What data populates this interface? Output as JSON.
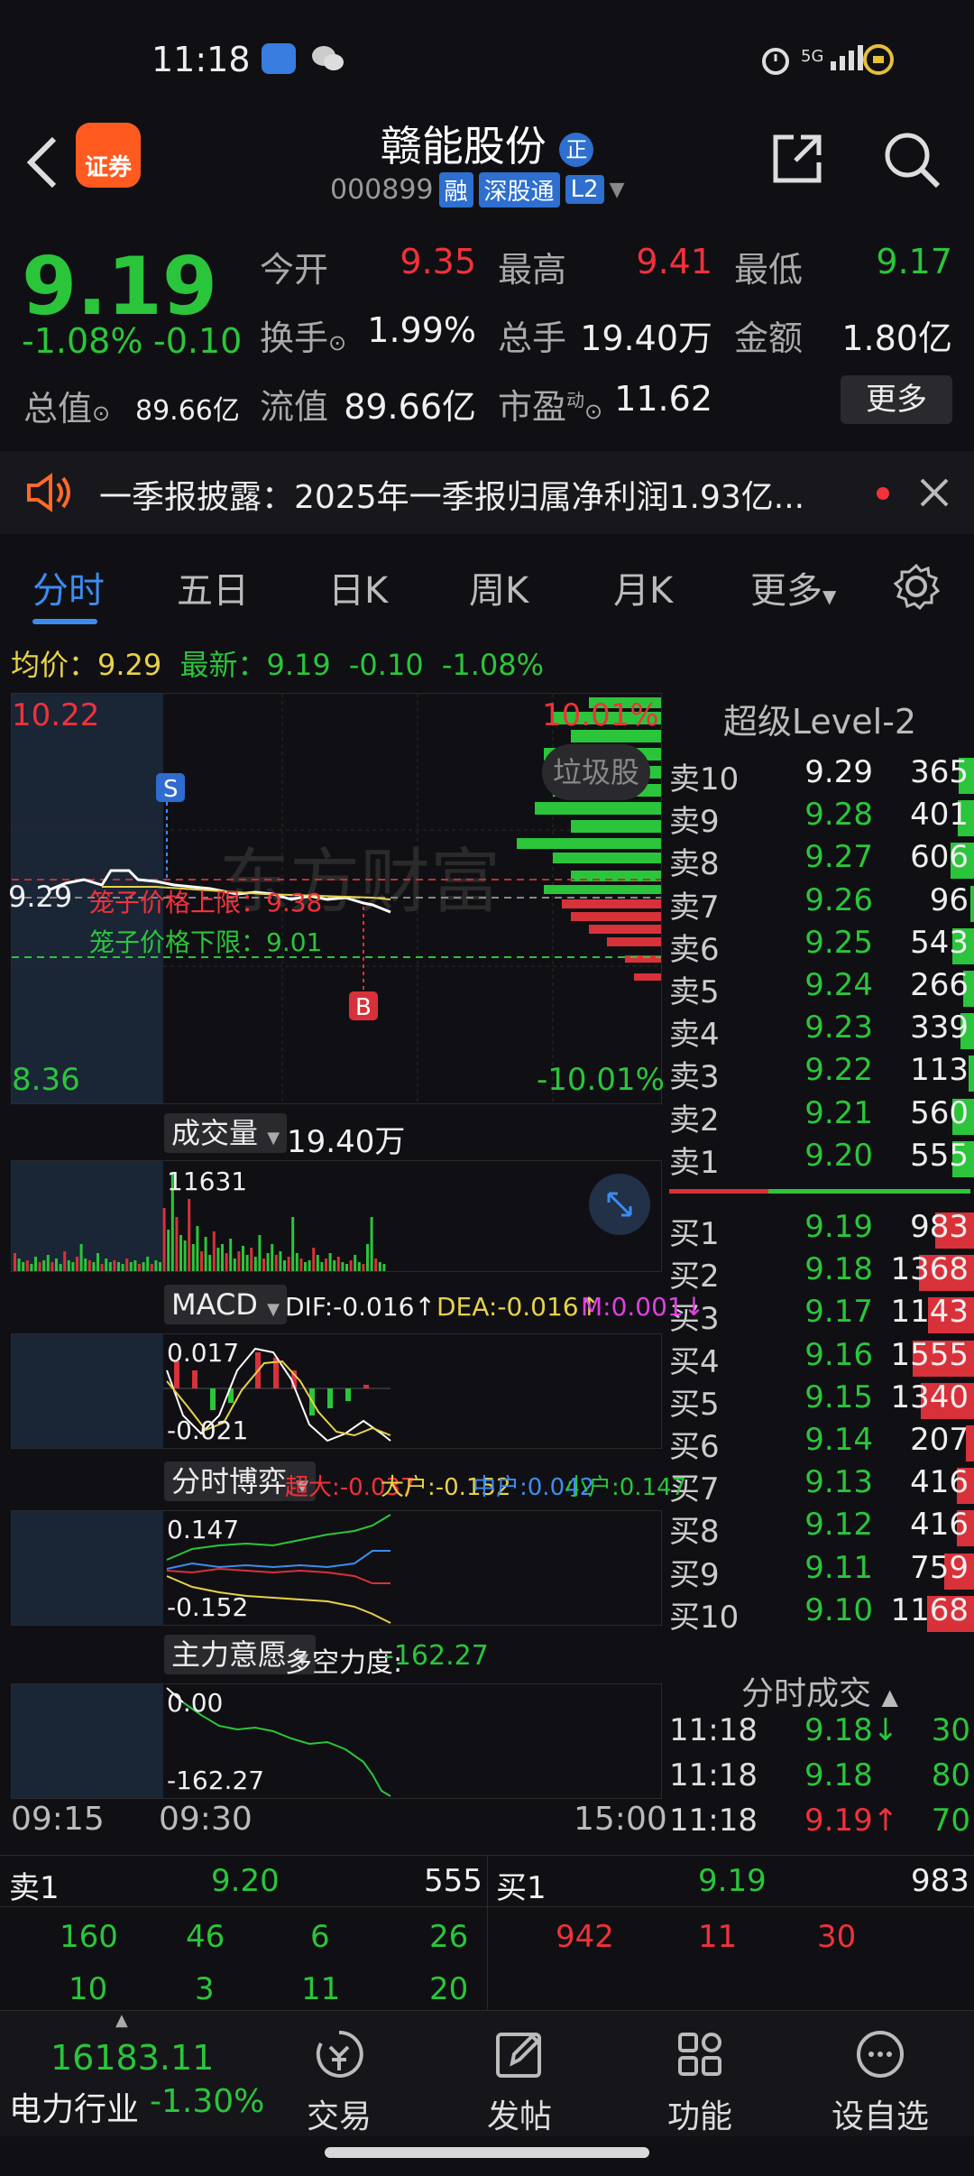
{
  "status_bar": {
    "time": "11:18",
    "network": "5G"
  },
  "header": {
    "logo_text": "证券",
    "stock_name": "赣能股份",
    "stock_code": "000899",
    "tags": [
      "融",
      "深股通",
      "L2"
    ]
  },
  "quote": {
    "price": "9.19",
    "change_pct": "-1.08%",
    "change_val": "-0.10",
    "open_label": "今开",
    "open": "9.35",
    "high_label": "最高",
    "high": "9.41",
    "low_label": "最低",
    "low": "9.17",
    "turnover_label": "换手",
    "turnover": "1.99%",
    "volume_label": "总手",
    "volume": "19.40万",
    "amount_label": "金额",
    "amount": "1.80亿",
    "mktcap_label": "总值",
    "mktcap": "89.66亿",
    "float_label": "流值",
    "float": "89.66亿",
    "pe_label": "市盈",
    "pe_sup": "动",
    "pe": "11.62",
    "more_label": "更多"
  },
  "notice": {
    "text": "一季报披露：2025年一季报归属净利润1.93亿..."
  },
  "tabs": [
    "分时",
    "五日",
    "日K",
    "周K",
    "月K",
    "更多"
  ],
  "avg_bar": {
    "avg_label": "均价：",
    "avg": "9.29",
    "latest_label": "最新：",
    "latest": "9.19",
    "chg": "-0.10",
    "pct": "-1.08%"
  },
  "chart": {
    "top_price": "10.22",
    "bottom_price": "8.36",
    "top_pct": "10.01%",
    "bottom_pct": "-10.01%",
    "mid_price": "9.29",
    "cage_upper": "笼子价格上限：9.38",
    "cage_lower": "笼子价格下限：9.01",
    "marker_s": "S",
    "marker_b": "B",
    "watermark": "东方财富",
    "overlay_btn": "垃圾股"
  },
  "volume_panel": {
    "title": "成交量",
    "value": "19.40万",
    "max": "11631"
  },
  "macd_panel": {
    "title": "MACD",
    "dif": "DIF:-0.016↑",
    "dea": "DEA:-0.016↑",
    "m": "M:0.001↓",
    "top": "0.017",
    "bottom": "-0.021"
  },
  "game_panel": {
    "title": "分时博弈",
    "xl": "超大:-0.037",
    "l": "大户:-0.152",
    "m": "中户:0.042",
    "s": "小户:0.147",
    "top": "0.147",
    "bottom": "-0.152"
  },
  "main_panel": {
    "title": "主力意愿",
    "info_label": "多空力度:",
    "info_val": "-162.27",
    "top": "0.00",
    "bottom": "-162.27"
  },
  "time_axis": [
    "09:15",
    "09:30",
    "15:00"
  ],
  "orderbook": {
    "title": "超级Level-2",
    "asks": [
      {
        "label": "卖10",
        "price": "9.29",
        "vol": "365",
        "fill": 0.15
      },
      {
        "label": "卖9",
        "price": "9.28",
        "vol": "401",
        "fill": 0.16
      },
      {
        "label": "卖8",
        "price": "9.27",
        "vol": "606",
        "fill": 0.24
      },
      {
        "label": "卖7",
        "price": "9.26",
        "vol": "96",
        "fill": 0.04
      },
      {
        "label": "卖6",
        "price": "9.25",
        "vol": "543",
        "fill": 0.22
      },
      {
        "label": "卖5",
        "price": "9.24",
        "vol": "266",
        "fill": 0.11
      },
      {
        "label": "卖4",
        "price": "9.23",
        "vol": "339",
        "fill": 0.14
      },
      {
        "label": "卖3",
        "price": "9.22",
        "vol": "113",
        "fill": 0.05
      },
      {
        "label": "卖2",
        "price": "9.21",
        "vol": "560",
        "fill": 0.22
      },
      {
        "label": "卖1",
        "price": "9.20",
        "vol": "555",
        "fill": 0.22
      }
    ],
    "bids": [
      {
        "label": "买1",
        "price": "9.19",
        "vol": "983",
        "fill": 0.39
      },
      {
        "label": "买2",
        "price": "9.18",
        "vol": "1368",
        "fill": 0.55
      },
      {
        "label": "买3",
        "price": "9.17",
        "vol": "1143",
        "fill": 0.46
      },
      {
        "label": "买4",
        "price": "9.16",
        "vol": "1555",
        "fill": 0.62
      },
      {
        "label": "买5",
        "price": "9.15",
        "vol": "1340",
        "fill": 0.54
      },
      {
        "label": "买6",
        "price": "9.14",
        "vol": "207",
        "fill": 0.08
      },
      {
        "label": "买7",
        "price": "9.13",
        "vol": "416",
        "fill": 0.17
      },
      {
        "label": "买8",
        "price": "9.12",
        "vol": "416",
        "fill": 0.17
      },
      {
        "label": "买9",
        "price": "9.11",
        "vol": "759",
        "fill": 0.3
      },
      {
        "label": "买10",
        "price": "9.10",
        "vol": "1168",
        "fill": 0.47
      }
    ],
    "ask_color": "#2bc53b",
    "bid_color": "#d9313a"
  },
  "ticks": {
    "title": "分时成交",
    "rows": [
      {
        "time": "11:18",
        "price": "9.18↓",
        "vol": "30"
      },
      {
        "time": "11:18",
        "price": "9.18",
        "vol": "80"
      },
      {
        "time": "11:18",
        "price": "9.19↑",
        "vol": "70"
      }
    ]
  },
  "bottom_book": {
    "sell_label": "卖1",
    "sell_price": "9.20",
    "sell_vol": "555",
    "buy_label": "买1",
    "buy_price": "9.19",
    "buy_vol": "983",
    "sell_queue": [
      "160",
      "46",
      "6",
      "26",
      "10",
      "3",
      "11",
      "20"
    ],
    "buy_queue": [
      "942",
      "11",
      "30"
    ]
  },
  "nav": {
    "index_value": "16183.11",
    "index_name": "电力行业",
    "index_pct": "-1.30%",
    "items": [
      "交易",
      "发帖",
      "功能",
      "设自选"
    ]
  }
}
